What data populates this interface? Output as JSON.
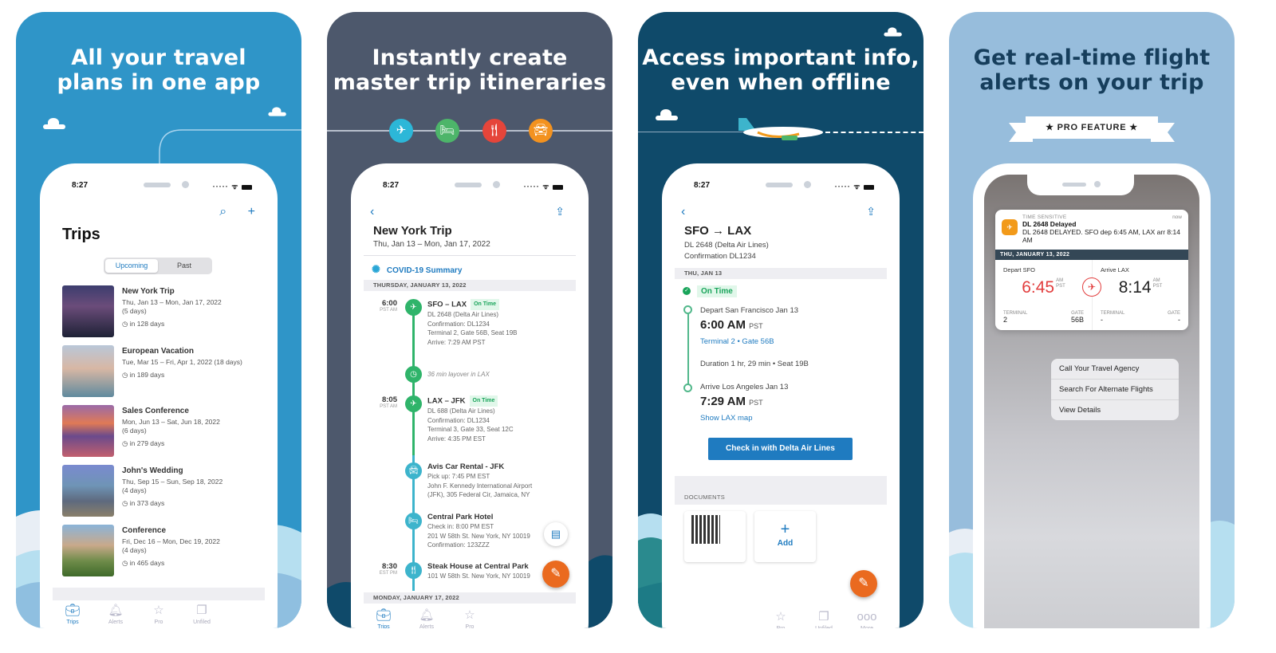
{
  "panel1": {
    "headline": [
      "All your travel",
      "plans in one app"
    ],
    "status_time": "8:27",
    "title": "Trips",
    "toolbar": {
      "search_icon": "⌕",
      "add_icon": "+"
    },
    "segments": {
      "active": "Upcoming",
      "inactive": "Past"
    },
    "trips": [
      {
        "name": "New York Trip",
        "dates": "Thu, Jan 13 – Mon, Jan 17, 2022",
        "duration": "(5 days)",
        "countdown": "in 128 days"
      },
      {
        "name": "European Vacation",
        "dates": "Tue, Mar 15 – Fri, Apr 1, 2022 (18 days)",
        "duration": "",
        "countdown": "in 189 days"
      },
      {
        "name": "Sales Conference",
        "dates": "Mon, Jun 13 – Sat, Jun 18, 2022",
        "duration": "(6 days)",
        "countdown": "in 279 days"
      },
      {
        "name": "John's Wedding",
        "dates": "Thu, Sep 15 – Sun, Sep 18, 2022",
        "duration": "(4 days)",
        "countdown": "in 373 days"
      },
      {
        "name": "Conference",
        "dates": "Fri, Dec 16 – Mon, Dec 19, 2022",
        "duration": "(4 days)",
        "countdown": "in 465 days"
      }
    ],
    "tabs": [
      "Trips",
      "Alerts",
      "Pro",
      "Unfiled"
    ]
  },
  "panel2": {
    "headline": [
      "Instantly create",
      "master trip itineraries"
    ],
    "status_time": "8:27",
    "trip_title": "New York Trip",
    "trip_dates": "Thu, Jan 13 – Mon, Jan 17, 2022",
    "covid_label": "COVID-19 Summary",
    "day1": "THURSDAY, JANUARY 13, 2022",
    "day2": "MONDAY, JANUARY 17, 2022",
    "events": {
      "f1": {
        "time": "6:00",
        "tz": "PST AM",
        "title": "SFO – LAX",
        "badge": "On Time",
        "l1": "DL 2648 (Delta Air Lines)",
        "l2": "Confirmation: DL1234",
        "l3": "Terminal 2, Gate 56B, Seat 19B",
        "l4": "Arrive: 7:29 AM PST"
      },
      "layover": "36 min layover in LAX",
      "f2": {
        "time": "8:05",
        "tz": "PST AM",
        "title": "LAX – JFK",
        "badge": "On Time",
        "l1": "DL 688 (Delta Air Lines)",
        "l2": "Confirmation: DL1234",
        "l3": "Terminal 3, Gate 33, Seat 12C",
        "l4": "Arrive: 4:35 PM EST"
      },
      "car": {
        "title": "Avis Car Rental - JFK",
        "l1": "Pick up: 7:45 PM EST",
        "l2": "John F. Kennedy International Airport",
        "l3": "(JFK), 305 Federal Cir, Jamaica, NY"
      },
      "hotel": {
        "title": "Central Park Hotel",
        "l1": "Check in: 8:00 PM EST",
        "l2": "201 W 58th St. New York, NY 10019",
        "l3": "Confirmation: 123ZZZ"
      },
      "dinner": {
        "time": "8:30",
        "tz": "EST PM",
        "title": "Steak House at Central Park",
        "l1": "101 W 58th St. New York, NY 10019"
      }
    },
    "tabs": [
      "Trips",
      "Alerts",
      "Pro"
    ]
  },
  "panel3": {
    "headline": [
      "Access important info,",
      "even when offline"
    ],
    "status_time": "8:27",
    "flight_title": "SFO → LAX",
    "flight_line1": "DL 2648 (Delta Air Lines)",
    "flight_line2": "Confirmation DL1234",
    "date_header": "THU, JAN 13",
    "status": "On Time",
    "depart_label": "Depart San Francisco Jan 13",
    "depart_time": "6:00 AM",
    "depart_tz": "PST",
    "depart_gate": "Terminal 2  •  Gate 56B",
    "duration": "Duration 1 hr, 29 min  •  Seat 19B",
    "arrive_label": "Arrive Los Angeles Jan 13",
    "arrive_time": "7:29 AM",
    "arrive_tz": "PST",
    "map_link": "Show LAX map",
    "checkin_button": "Check in with Delta Air Lines",
    "documents_label": "DOCUMENTS",
    "add_label": "Add",
    "tabs": [
      "Pro",
      "Unfiled",
      "More"
    ]
  },
  "panel4": {
    "headline": [
      "Get real-time flight",
      "alerts on your trip"
    ],
    "ribbon": "★  PRO FEATURE  ★",
    "notification": {
      "category": "TIME SENSITIVE",
      "time": "now",
      "title": "DL 2648 Delayed",
      "body": "DL 2648 DELAYED. SFO  dep 6:45 AM, LAX  arr 8:14 AM",
      "date": "THU, JANUARY 13, 2022",
      "depart_label": "Depart SFO",
      "depart_time": "6:45",
      "depart_ampm": "AM",
      "depart_tz": "PST",
      "arrive_label": "Arrive LAX",
      "arrive_time": "8:14",
      "arrive_ampm": "AM",
      "arrive_tz": "PST",
      "terminal_label": "TERMINAL",
      "gate_label": "GATE",
      "depart_terminal": "2",
      "depart_gate": "56B",
      "arrive_terminal": "-",
      "arrive_gate": "-"
    },
    "menu": [
      "Call Your Travel Agency",
      "Search For Alternate Flights",
      "View Details"
    ]
  },
  "colors": {
    "brand_blue": "#1f7bc0",
    "on_time_green": "#19a45a",
    "delay_red": "#e23d3d",
    "fab_orange": "#ea6a1f"
  }
}
